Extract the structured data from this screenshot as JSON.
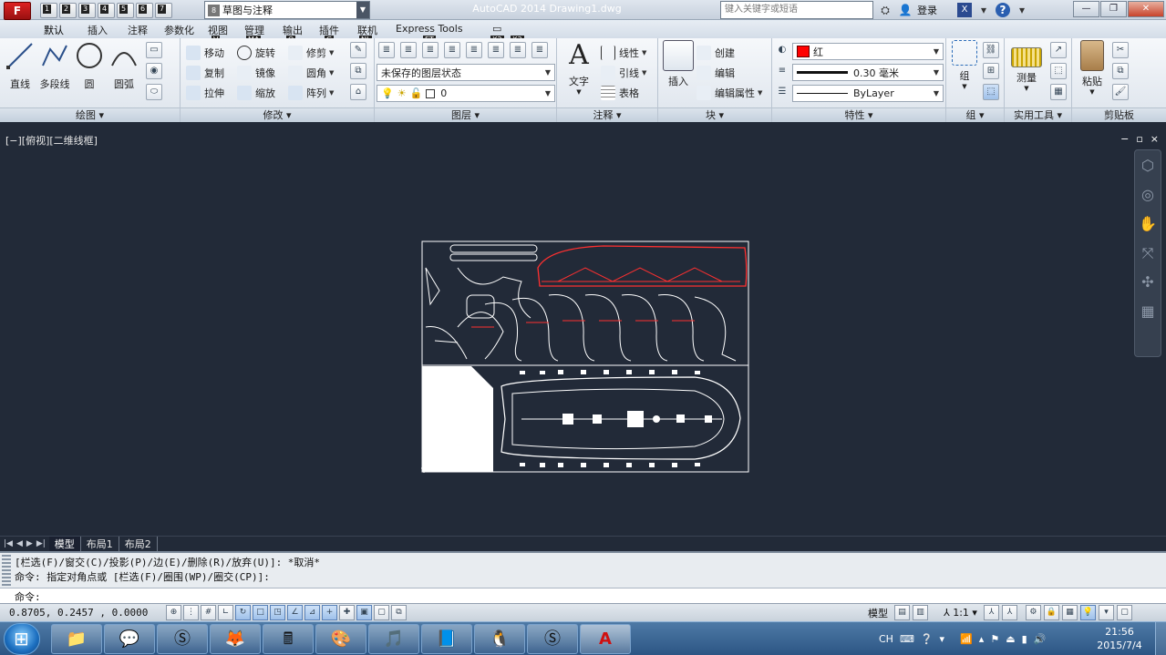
{
  "title_bar": {
    "app_button": "F",
    "doc_title": "AutoCAD 2014    Drawing1.dwg",
    "workspace": "草图与注释",
    "workspace_icon": "8",
    "search_placeholder": "键入关键字或短语",
    "login": "登录",
    "quick_access": [
      {
        "key": "1",
        "icon": "new-icon"
      },
      {
        "key": "2",
        "icon": "open-icon"
      },
      {
        "key": "3",
        "icon": "save-icon"
      },
      {
        "key": "4",
        "icon": "saveas-icon"
      },
      {
        "key": "5",
        "icon": "plot-icon"
      },
      {
        "key": "6",
        "icon": "undo-icon"
      },
      {
        "key": "7",
        "icon": "redo-icon"
      }
    ]
  },
  "watermark": {
    "text": "…"
  },
  "ribbon_tabs": [
    {
      "label": "默认",
      "key": "H"
    },
    {
      "label": "插入",
      "key": "I"
    },
    {
      "label": "注释",
      "key": "N"
    },
    {
      "label": "参数化",
      "key": "C"
    },
    {
      "label": "视图",
      "key": "V"
    },
    {
      "label": "管理",
      "key": "MA"
    },
    {
      "label": "输出",
      "key": "O"
    },
    {
      "label": "插件",
      "key": "G"
    },
    {
      "label": "联机",
      "key": "NL"
    },
    {
      "label": "Express Tools",
      "key": "ET"
    },
    {
      "label": "",
      "key": "X2"
    },
    {
      "label": "",
      "key": "X3"
    }
  ],
  "panels": {
    "draw": {
      "title": "绘图",
      "line": "直线",
      "polyline": "多段线",
      "circle": "圆",
      "arc": "圆弧"
    },
    "modify": {
      "title": "修改",
      "move": "移动",
      "rotate": "旋转",
      "trim": "修剪",
      "copy": "复制",
      "mirror": "镜像",
      "fillet": "圆角",
      "stretch": "拉伸",
      "scale": "缩放",
      "array": "阵列"
    },
    "layers": {
      "title": "图层",
      "layer_state": "未保存的图层状态",
      "current_layer": "0"
    },
    "annotation": {
      "title": "注释",
      "text": "文字",
      "linear": "线性",
      "leader": "引线",
      "table": "表格"
    },
    "block": {
      "title": "块",
      "insert": "插入",
      "create": "创建",
      "edit": "编辑",
      "edit_attr": "编辑属性"
    },
    "properties": {
      "title": "特性",
      "color": "红",
      "color_hex": "#ff0000",
      "lineweight": "0.30 毫米",
      "linetype": "ByLayer"
    },
    "groups": {
      "title": "组",
      "group": "组"
    },
    "utilities": {
      "title": "实用工具",
      "measure": "测量"
    },
    "clipboard": {
      "title": "剪贴板",
      "paste": "粘贴"
    }
  },
  "viewport": {
    "label": "[−][俯视][二维线框]",
    "controls": [
      "−",
      "▫",
      "×"
    ]
  },
  "layout_tabs": [
    "模型",
    "布局1",
    "布局2"
  ],
  "command": {
    "history": [
      "[栏选(F)/窗交(C)/投影(P)/边(E)/删除(R)/放弃(U)]:  *取消*",
      "命令: 指定对角点或 [栏选(F)/圈围(WP)/圈交(CP)]:"
    ],
    "prompt": "命令:"
  },
  "status": {
    "coords": "0.8705, 0.2457 , 0.0000",
    "model": "模型",
    "scale": "1:1"
  },
  "taskbar": {
    "apps": [
      "explorer-icon",
      "wechat-icon",
      "sogou-icon",
      "foxmail-icon",
      "calculator-icon",
      "paint-icon",
      "music-icon",
      "notepad-icon",
      "qq-icon",
      "skype-icon",
      "autocad-icon"
    ],
    "ime": "CH",
    "time": "21:56",
    "date": "2015/7/4"
  }
}
